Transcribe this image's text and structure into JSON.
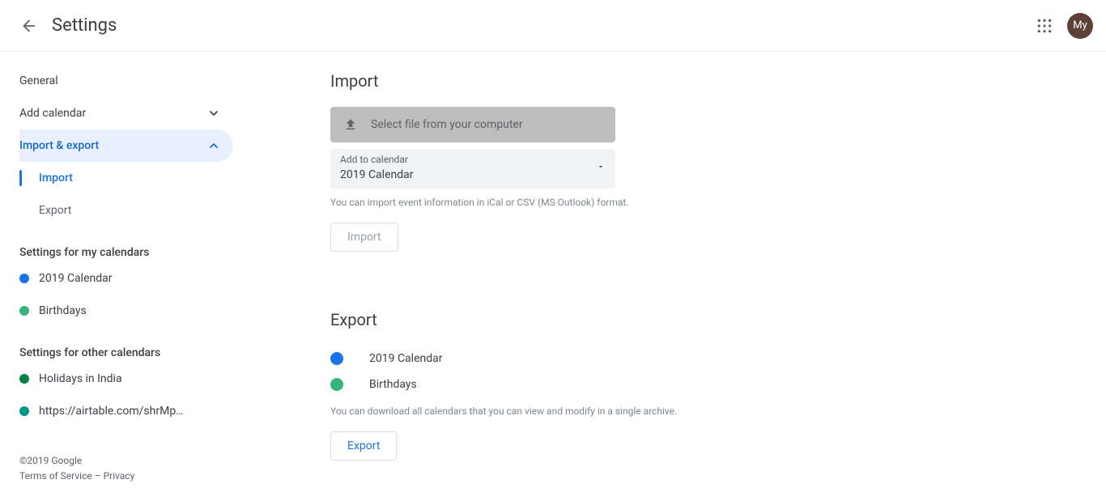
{
  "header": {
    "title": "Settings",
    "avatar_text": "My"
  },
  "sidebar": {
    "nav": {
      "general": "General",
      "add_calendar": "Add calendar",
      "import_export": "Import & export",
      "subs": {
        "import": "Import",
        "export": "Export"
      }
    },
    "my_heading": "Settings for my calendars",
    "my_cals": [
      {
        "label": "2019 Calendar",
        "color": "#1a73e8"
      },
      {
        "label": "Birthdays",
        "color": "#33b679"
      }
    ],
    "other_heading": "Settings for other calendars",
    "other_cals": [
      {
        "label": "Holidays in India",
        "color": "#0b8043"
      },
      {
        "label": "https://airtable.com/shrMp…",
        "color": "#009688"
      }
    ]
  },
  "panels": {
    "import": {
      "title": "Import",
      "file_label": "Select file from your computer",
      "add_to_label": "Add to calendar",
      "add_to_value": "2019 Calendar",
      "hint": "You can import event information in iCal or CSV (MS Outlook) format.",
      "button": "Import"
    },
    "export": {
      "title": "Export",
      "cals": [
        {
          "label": "2019 Calendar",
          "color": "#1a73e8"
        },
        {
          "label": "Birthdays",
          "color": "#33b679"
        }
      ],
      "hint": "You can download all calendars that you can view and modify in a single archive.",
      "button": "Export"
    }
  },
  "footer": {
    "copyright": "©2019 Google",
    "tos": "Terms of Service",
    "sep": " – ",
    "privacy": "Privacy"
  }
}
